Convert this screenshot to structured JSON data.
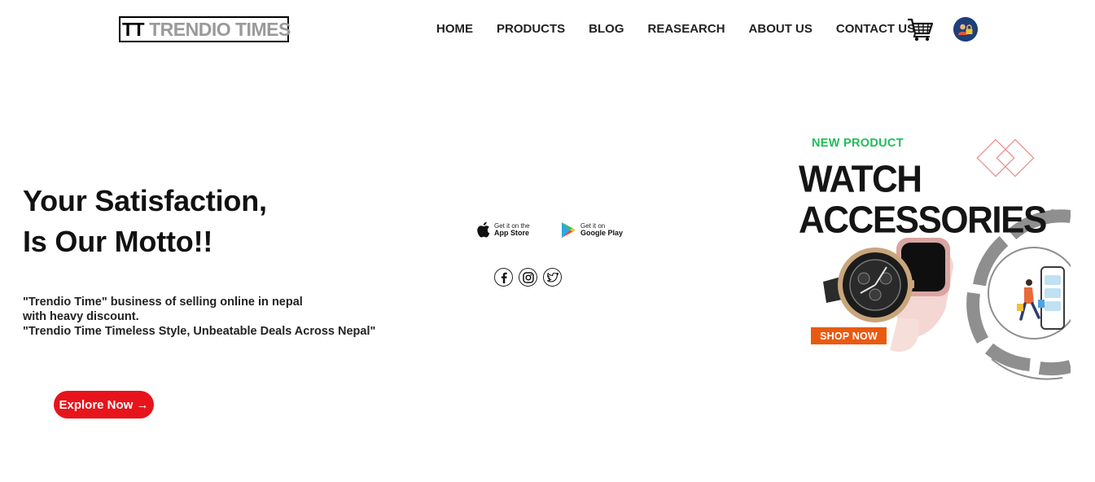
{
  "brand": {
    "mark": "TT",
    "name": "TRENDIO TIMES"
  },
  "nav": [
    "HOME",
    "PRODUCTS",
    "BLOG",
    "REASEARCH",
    "ABOUT US",
    "CONTACT US"
  ],
  "header_icons": {
    "cart": "shopping-cart-icon",
    "account": "user-avatar-icon"
  },
  "hero": {
    "headline": [
      "Your Satisfaction,",
      "Is Our Motto!!"
    ],
    "description": [
      "\"Trendio Time\" business of selling online in nepal",
      "with heavy discount.",
      "\"Trendio Time Timeless Style, Unbeatable Deals Across Nepal\""
    ],
    "cta": "Explore Now →"
  },
  "stores": {
    "apple": {
      "small": "Get it on the",
      "big": "App Store",
      "icon": "apple-icon"
    },
    "google": {
      "small": "Get it on",
      "big": "Google Play",
      "icon": "google-play-icon"
    }
  },
  "social": [
    "facebook-icon",
    "instagram-icon",
    "twitter-icon"
  ],
  "promo": {
    "tag": "NEW PRODUCT",
    "title_line1": "WATCH",
    "title_line2": "ACCESSORIES",
    "button": "SHOP NOW"
  },
  "colors": {
    "cta": "#e8141c",
    "promo_tag": "#1cbf57",
    "promo_button": "#e95a10",
    "brand_name": "#9a9a9a"
  }
}
